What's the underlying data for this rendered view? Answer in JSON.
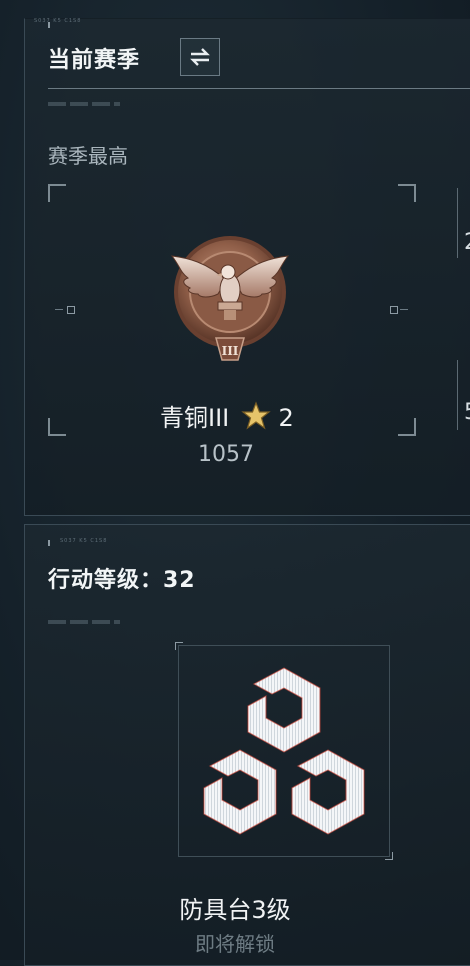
{
  "season": {
    "header_code": "S037 K5 C1S8",
    "title": "当前赛季",
    "subtitle": "赛季最高",
    "rank_name": "青铜III",
    "rank_stars": "2",
    "score": "1057",
    "rank_badge_numeral": "III",
    "right_partial_1": "2",
    "right_partial_2": "5"
  },
  "action": {
    "header_code": "S037 K5 C1S8",
    "title": "行动等级：32",
    "reward_name": "防具台3级",
    "reward_status": "即将解锁"
  },
  "icons": {
    "swap": "swap-arrows-icon",
    "star": "star-icon",
    "badge": "bronze-eagle-badge-icon",
    "cubes": "armor-bench-cubes-icon"
  },
  "colors": {
    "background": "#15212a",
    "bronze": "#9a6a52",
    "star_gold": "#e6c46a"
  }
}
